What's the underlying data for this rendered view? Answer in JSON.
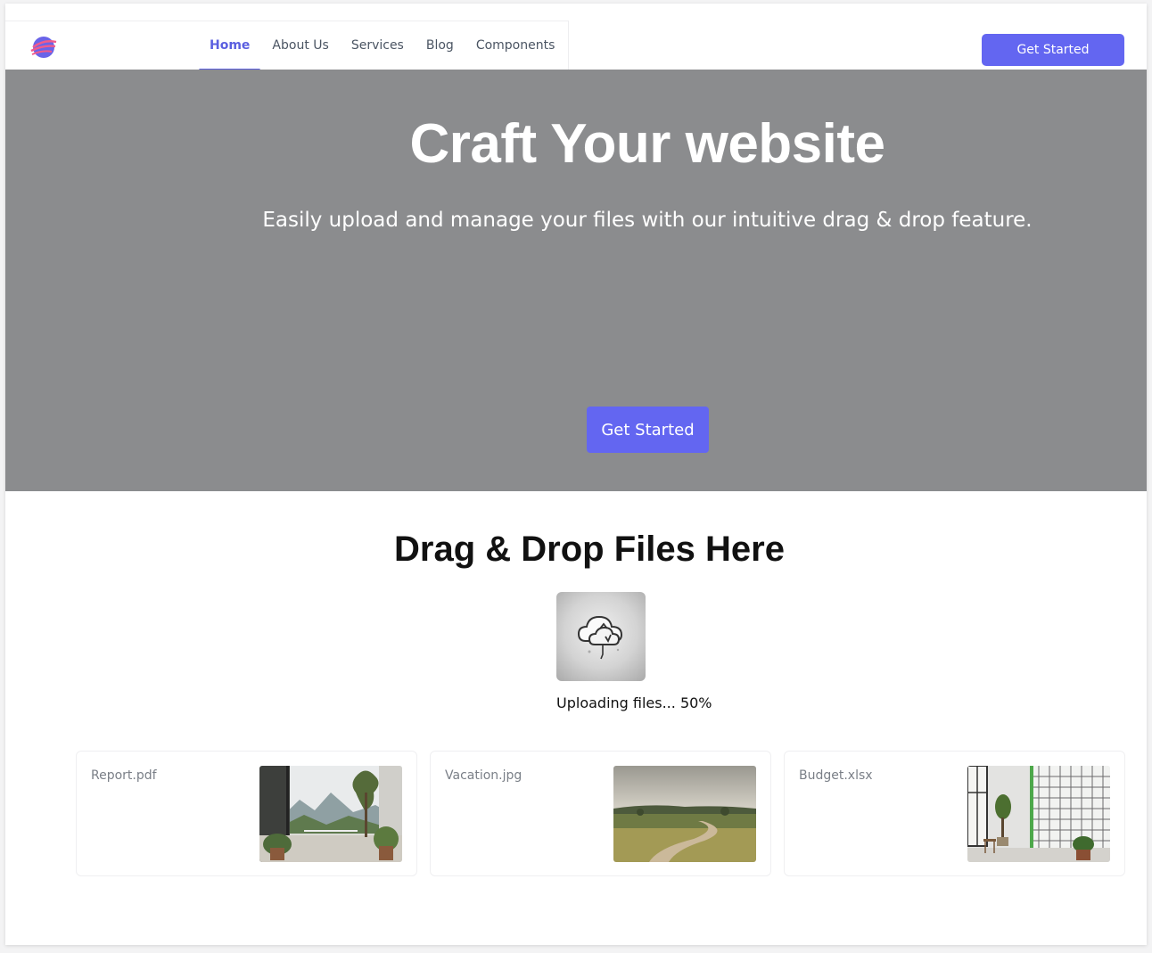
{
  "colors": {
    "accent": "#6366f1",
    "active_nav": "#5b5fe0",
    "hero_bg": "#8b8c8e",
    "page_bg": "#ffffff"
  },
  "header": {
    "logo_icon": "planet-logo-icon",
    "nav": [
      {
        "label": "Home",
        "active": true
      },
      {
        "label": "About Us",
        "active": false
      },
      {
        "label": "Services",
        "active": false
      },
      {
        "label": "Blog",
        "active": false
      },
      {
        "label": "Components",
        "active": false
      }
    ],
    "cta_label": "Get Started"
  },
  "hero": {
    "title": "Craft Your website",
    "subtitle": "Easily upload and manage your files with our intuitive drag & drop feature.",
    "cta_label": "Get Started"
  },
  "upload": {
    "title": "Drag & Drop Files Here",
    "icon": "cloud-upload-icon",
    "status": "Uploading files... 50%",
    "progress_percent": 50
  },
  "files": [
    {
      "name": "Report.pdf",
      "thumbnail": "interior-terrace-mountains-image"
    },
    {
      "name": "Vacation.jpg",
      "thumbnail": "countryside-dirt-road-image"
    },
    {
      "name": "Budget.xlsx",
      "thumbnail": "bright-room-window-plants-image"
    }
  ]
}
